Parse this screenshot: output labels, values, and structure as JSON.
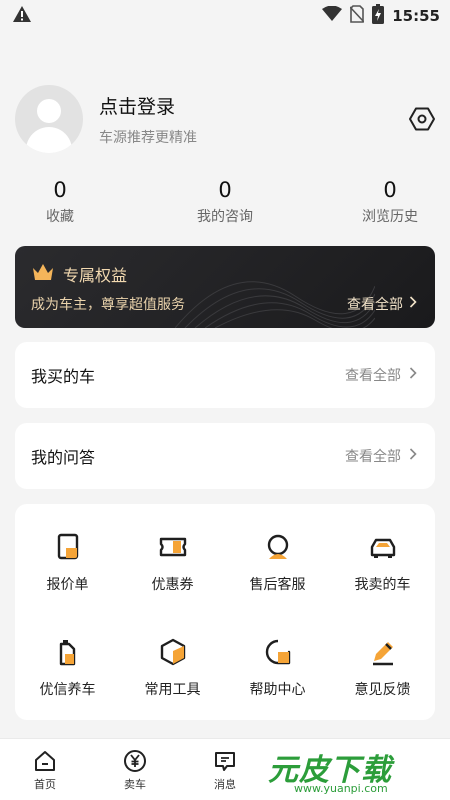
{
  "status_bar": {
    "time": "15:55",
    "icons": [
      "warning-icon",
      "wifi-icon",
      "no-sim-icon",
      "battery-charging-icon"
    ]
  },
  "profile": {
    "login_text": "点击登录",
    "subtitle": "车源推荐更精准",
    "settings_icon": "hexagon-settings-icon"
  },
  "stats": [
    {
      "value": "0",
      "label": "收藏"
    },
    {
      "value": "0",
      "label": "我的咨询"
    },
    {
      "value": "0",
      "label": "浏览历史"
    }
  ],
  "vip": {
    "title": "专属权益",
    "subtitle": "成为车主，尊享超值服务",
    "more": "查看全部",
    "icon": "crown-icon"
  },
  "bought_cars": {
    "title": "我买的车",
    "more": "查看全部"
  },
  "my_qa": {
    "title": "我的问答",
    "more": "查看全部"
  },
  "tools": [
    {
      "label": "报价单",
      "icon": "quote-doc-icon"
    },
    {
      "label": "优惠券",
      "icon": "coupon-icon"
    },
    {
      "label": "售后客服",
      "icon": "customer-service-icon"
    },
    {
      "label": "我卖的车",
      "icon": "car-icon"
    },
    {
      "label": "优信养车",
      "icon": "oil-can-icon"
    },
    {
      "label": "常用工具",
      "icon": "box-icon"
    },
    {
      "label": "帮助中心",
      "icon": "chat-bubble-icon"
    },
    {
      "label": "意见反馈",
      "icon": "pencil-icon"
    }
  ],
  "tabbar": [
    {
      "label": "首页",
      "icon": "home-icon"
    },
    {
      "label": "卖车",
      "icon": "yen-icon"
    },
    {
      "label": "消息",
      "icon": "message-icon"
    }
  ],
  "watermark": {
    "text": "元皮下载",
    "url": "www.yuanpi.com"
  },
  "colors": {
    "accent": "#f5a437",
    "dark_card": "#1f1f21",
    "gold_text": "#f2d9b0",
    "watermark_green": "#2c9d3a"
  }
}
